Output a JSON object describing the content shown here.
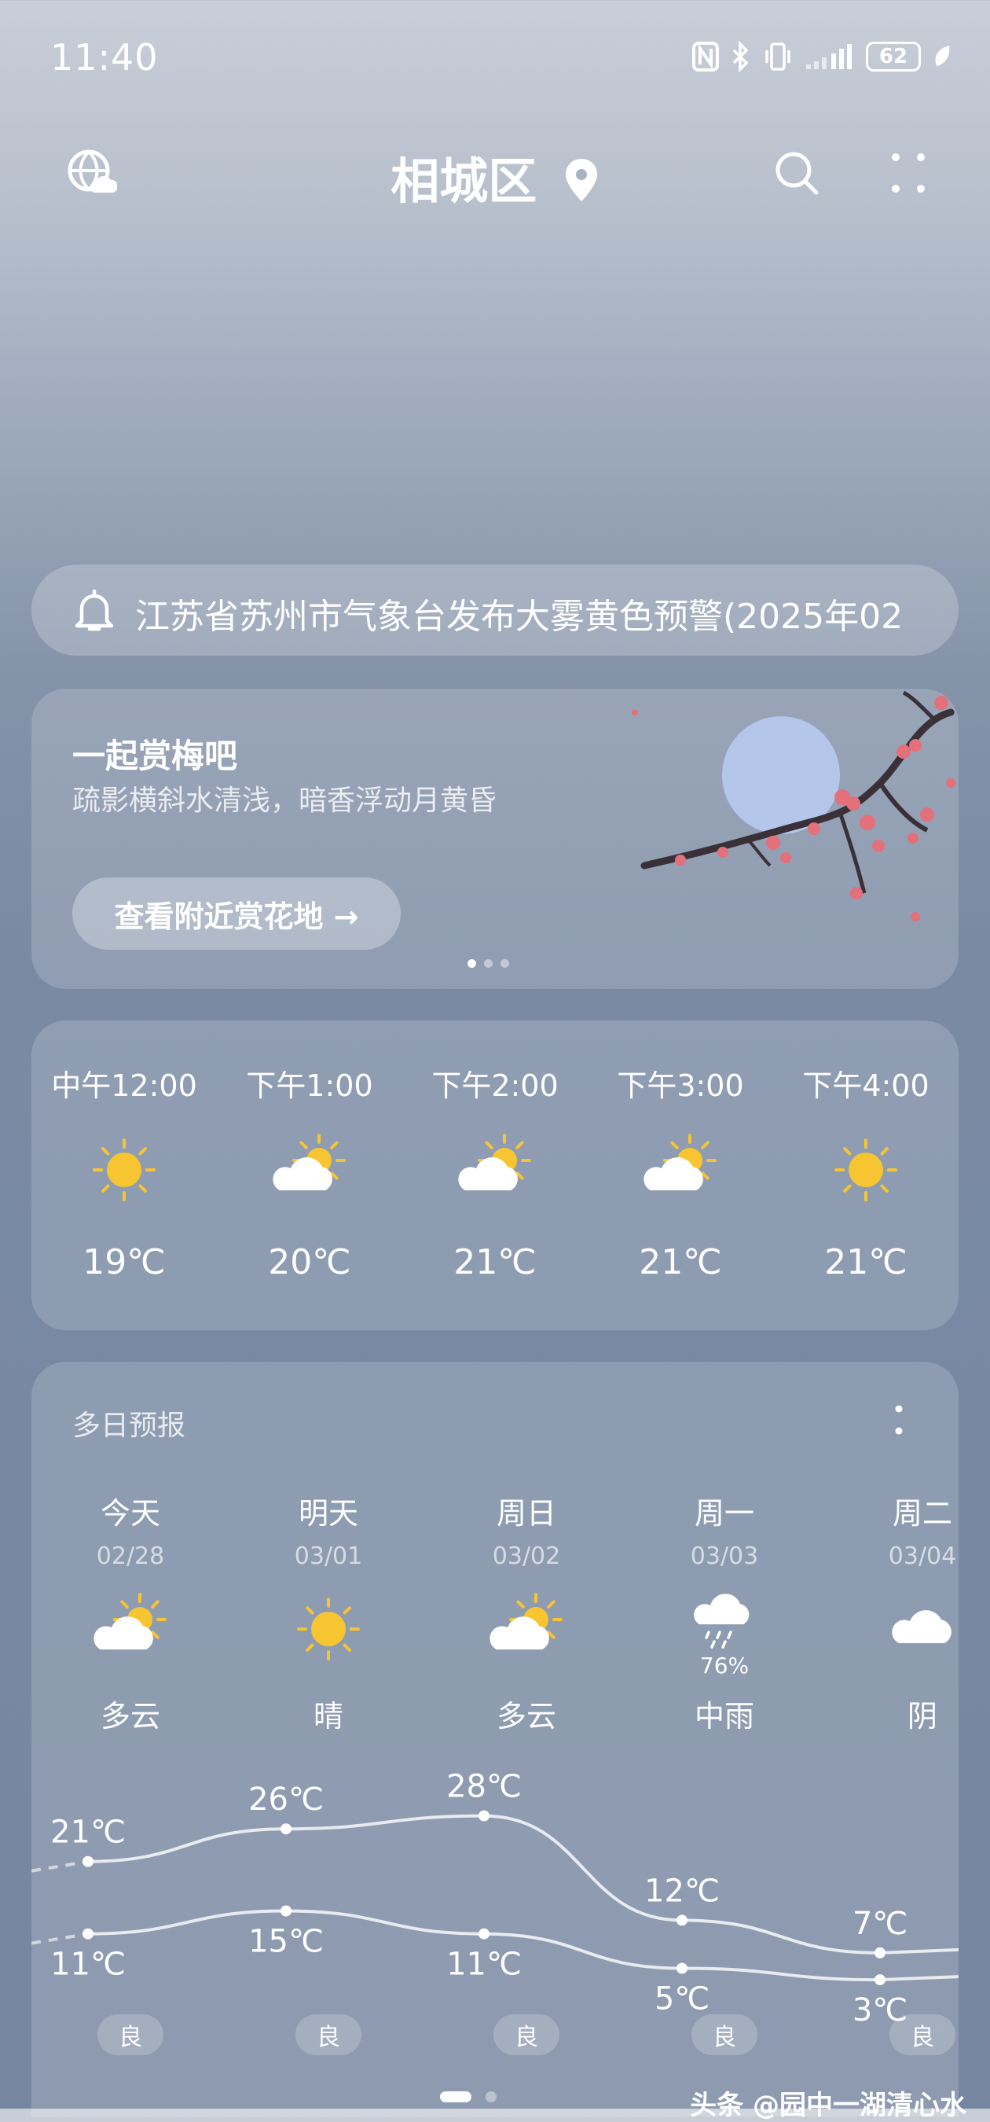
{
  "status_bar": {
    "time": "11:40",
    "battery": "62"
  },
  "header": {
    "city": "相城区"
  },
  "alert": {
    "text": "江苏省苏州市气象台发布大雾黄色预警(2025年02"
  },
  "promo": {
    "title": "一起赏梅吧",
    "subtitle": "疏影横斜水清浅，暗香浮动月黄昏",
    "button": "查看附近赏花地 →"
  },
  "hourly": [
    {
      "time": "中午12:00",
      "icon": "sun-icon",
      "temp": "19℃"
    },
    {
      "time": "下午1:00",
      "icon": "partly-cloudy-icon",
      "temp": "20℃"
    },
    {
      "time": "下午2:00",
      "icon": "partly-cloudy-icon",
      "temp": "21℃"
    },
    {
      "time": "下午3:00",
      "icon": "partly-cloudy-icon",
      "temp": "21℃"
    },
    {
      "time": "下午4:00",
      "icon": "sun-icon",
      "temp": "21℃"
    }
  ],
  "daily": {
    "title": "多日预报",
    "days": [
      {
        "day": "今天",
        "date": "02/28",
        "icon": "partly-cloudy-icon",
        "prob": "",
        "cond": "多云",
        "high": 21,
        "low": 11,
        "high_label": "21℃",
        "low_label": "11℃",
        "aq": "良"
      },
      {
        "day": "明天",
        "date": "03/01",
        "icon": "sun-icon",
        "prob": "",
        "cond": "晴",
        "high": 26,
        "low": 15,
        "high_label": "26℃",
        "low_label": "15℃",
        "aq": "良"
      },
      {
        "day": "周日",
        "date": "03/02",
        "icon": "partly-cloudy-icon",
        "prob": "",
        "cond": "多云",
        "high": 28,
        "low": 11,
        "high_label": "28℃",
        "low_label": "11℃",
        "aq": "良"
      },
      {
        "day": "周一",
        "date": "03/03",
        "icon": "rain-icon",
        "prob": "76%",
        "cond": "中雨",
        "high": 12,
        "low": 5,
        "high_label": "12℃",
        "low_label": "5℃",
        "aq": "良"
      },
      {
        "day": "周二",
        "date": "03/04",
        "icon": "cloudy-icon",
        "prob": "",
        "cond": "阴",
        "high": 7,
        "low": 3,
        "high_label": "7℃",
        "low_label": "3℃",
        "aq": "良"
      }
    ]
  },
  "watermark": "头条 @园中一湖清心水",
  "colors": {
    "sun": "#f7c531",
    "cloud": "#ffffff",
    "card": "rgba(255,255,255,0.17)"
  }
}
